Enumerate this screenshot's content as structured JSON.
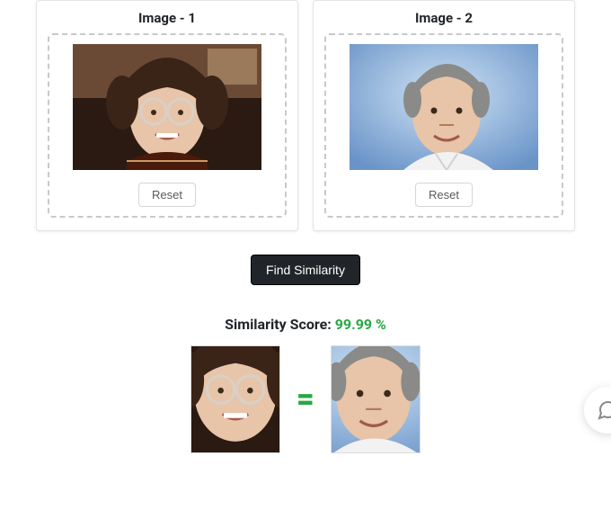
{
  "cards": [
    {
      "title": "Image - 1",
      "reset_label": "Reset"
    },
    {
      "title": "Image - 2",
      "reset_label": "Reset"
    }
  ],
  "find_button_label": "Find Similarity",
  "score": {
    "label": "Similarity Score:",
    "value": "99.99 %",
    "symbol": "="
  },
  "colors": {
    "accent_green": "#28a745",
    "button_dark": "#212529"
  },
  "icons": {
    "chat": "chat-bubble-icon"
  }
}
